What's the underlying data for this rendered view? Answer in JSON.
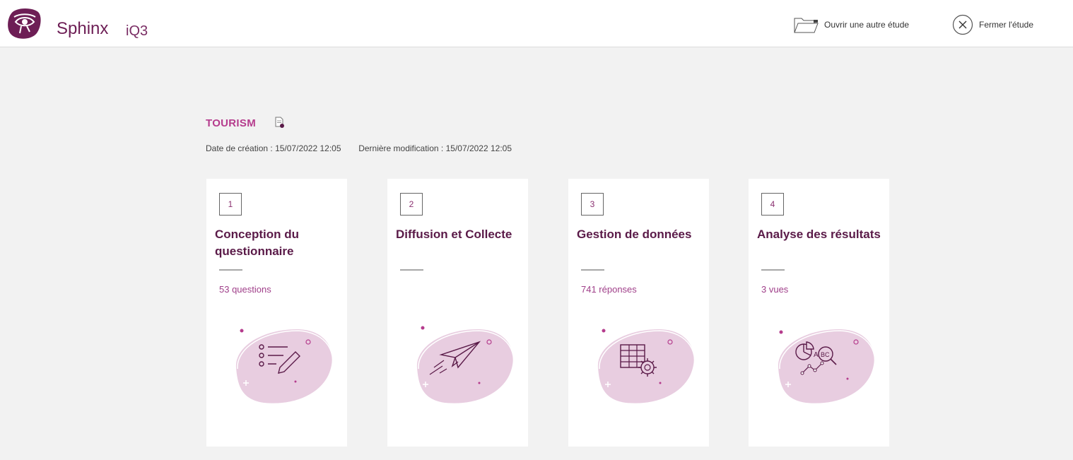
{
  "app": {
    "brand_name": "Sphinx",
    "brand_sub": "iQ3",
    "actions": {
      "open_other": "Ouvrir une autre étude",
      "close_study": "Fermer l'étude"
    }
  },
  "study": {
    "title": "TOURISM",
    "created_label": "Date de création :",
    "created_value": "15/07/2022 12:05",
    "modified_label": "Dernière modification :",
    "modified_value": "15/07/2022 12:05"
  },
  "cards": [
    {
      "step": "1",
      "title": "Conception du questionnaire",
      "stat": "53 questions",
      "icon": "questionnaire-icon"
    },
    {
      "step": "2",
      "title": "Diffusion et Collecte",
      "stat": "",
      "icon": "paper-plane-icon"
    },
    {
      "step": "3",
      "title": "Gestion de données",
      "stat": "741 réponses",
      "icon": "table-gear-icon"
    },
    {
      "step": "4",
      "title": "Analyse des résultats",
      "stat": "3 vues",
      "icon": "analysis-icon"
    }
  ],
  "colors": {
    "brand": "#6d1e55",
    "accent": "#b53c8d",
    "blob": "#e8cde0",
    "background": "#f2f2f2"
  }
}
